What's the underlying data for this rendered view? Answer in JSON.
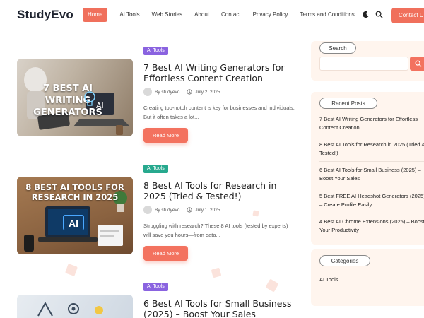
{
  "header": {
    "logo": "StudyEvo",
    "nav": [
      {
        "label": "Home",
        "active": true
      },
      {
        "label": "AI Tools",
        "active": false
      },
      {
        "label": "Web Stories",
        "active": false
      },
      {
        "label": "About",
        "active": false
      },
      {
        "label": "Contact",
        "active": false
      },
      {
        "label": "Privacy Policy",
        "active": false
      },
      {
        "label": "Terms and Conditions",
        "active": false
      }
    ],
    "theme_icon": "moon-icon",
    "search_icon": "search-icon",
    "contact_button": "Contact U"
  },
  "posts": [
    {
      "category": "AI Tools",
      "category_color": "#8a63e0",
      "image_caption": "7 BEST AI WRITING GENERATORS",
      "title": "7 Best AI Writing Generators for Effortless Content Creation",
      "author": "By studyevo",
      "date": "July 2, 2025",
      "excerpt": "Creating top-notch content is key for businesses and individuals. But it often takes a lot...",
      "read_more": "Read More"
    },
    {
      "category": "AI Tools",
      "category_color": "#27a98e",
      "image_caption": "8 BEST AI TOOLS FOR RESEARCH IN 2025",
      "image_badge": "AI",
      "title": "8 Best AI Tools for Research in 2025 (Tried & Tested!)",
      "author": "By studyevo",
      "date": "July 1, 2025",
      "excerpt": "Struggling with research? These 8 AI tools (tested by experts) will save you hours—from data...",
      "read_more": "Read More"
    },
    {
      "category": "AI Tools",
      "category_color": "#8a63e0",
      "title": "6 Best AI Tools for Small Business (2025) – Boost Your Sales"
    }
  ],
  "sidebar": {
    "search": {
      "label": "Search",
      "placeholder": ""
    },
    "recent": {
      "label": "Recent Posts",
      "items": [
        "7 Best AI Writing Generators for Effortless Content Creation",
        "8 Best AI Tools for Research in 2025 (Tried & Tested!)",
        "6 Best AI Tools for Small Business (2025) – Boost Your Sales",
        "5 Best FREE AI Headshot Generators (2025) – Create Profile Easily",
        "4 Best AI Chrome Extensions (2025) – Boost Your Productivity"
      ]
    },
    "categories": {
      "label": "Categories",
      "items": [
        "AI Tools"
      ]
    }
  },
  "colors": {
    "accent": "#f0705c",
    "widget_bg": "#fff5ee"
  }
}
